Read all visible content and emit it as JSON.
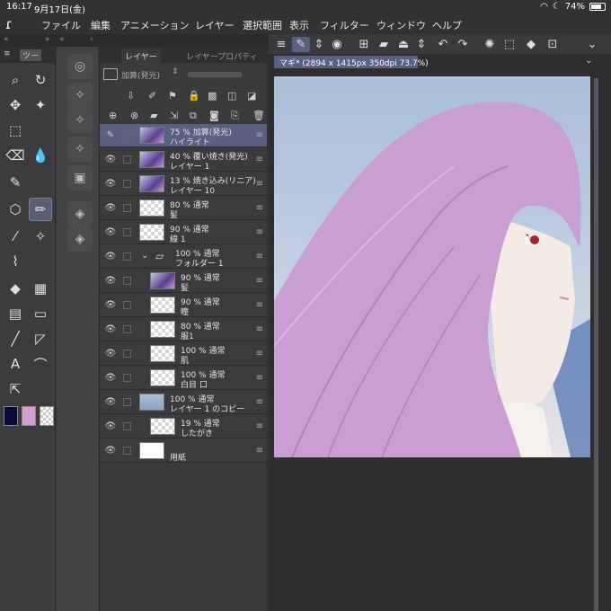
{
  "status": {
    "time": "16:17",
    "date": "9月17日(金)",
    "battery": "74%"
  },
  "menu": [
    "ファイル",
    "編集",
    "アニメーション",
    "レイヤー",
    "選択範囲",
    "表示",
    "フィルター",
    "ウィンドウ",
    "ヘルプ"
  ],
  "tool_panel": {
    "tab_label": "ツー"
  },
  "layer_panel": {
    "tabs": [
      "レイヤー",
      "レイヤープロパティ"
    ],
    "blend_mode": "加算(発光)"
  },
  "layers": [
    {
      "line1": "75 % 加算(発光)",
      "line2": "ハイライト",
      "selected": true,
      "thumb": "img"
    },
    {
      "line1": "40 % 覆い焼き(発光)",
      "line2": "レイヤー 1",
      "thumb": "img"
    },
    {
      "line1": "13 % 焼き込み(リニア)",
      "line2": "レイヤー 10",
      "thumb": "img"
    },
    {
      "line1": "80 % 通常",
      "line2": "髪",
      "thumb": "empty"
    },
    {
      "line1": "90 % 通常",
      "line2": "線 1",
      "thumb": "empty"
    },
    {
      "line1": "100 % 通常",
      "line2": "フォルダー 1",
      "folder": true
    },
    {
      "line1": "90 % 通常",
      "line2": "髪",
      "indent": true,
      "thumb": "img"
    },
    {
      "line1": "90 % 通常",
      "line2": "瞳",
      "indent": true,
      "thumb": "empty"
    },
    {
      "line1": "80 % 通常",
      "line2": "服1",
      "indent": true,
      "thumb": "empty"
    },
    {
      "line1": "100 % 通常",
      "line2": "肌",
      "indent": true,
      "thumb": "empty"
    },
    {
      "line1": "100 % 通常",
      "line2": "白目 口",
      "indent": true,
      "thumb": "empty"
    },
    {
      "line1": "100 % 通常",
      "line2": "レイヤー 1 のコピー",
      "thumb": "photo"
    },
    {
      "line1": "19 % 通常",
      "line2": "したがき",
      "thumb": "empty",
      "indent": true
    },
    {
      "line1": "",
      "line2": "用紙",
      "thumb": "white"
    }
  ],
  "canvas": {
    "doc_title": "マギ* (2894 x 1415px 350dpi 73.7%)"
  },
  "colors": {
    "main": "#0b0b3a",
    "sub": "#d7a0d4",
    "accent": "#5a6080"
  }
}
